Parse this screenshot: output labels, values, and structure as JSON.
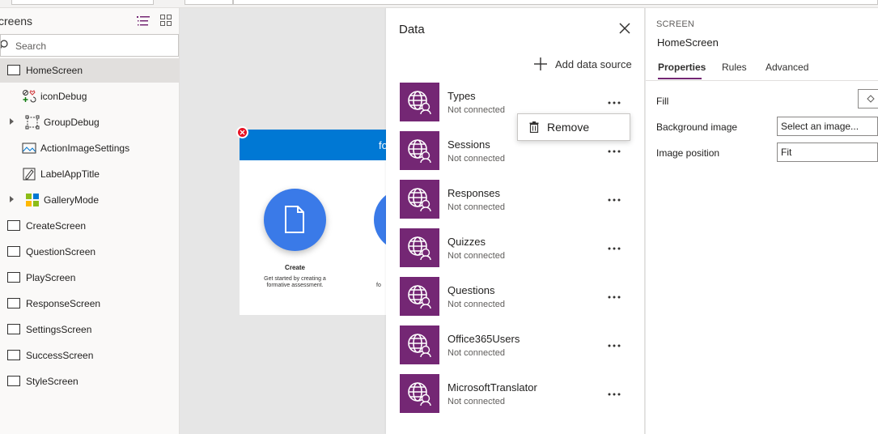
{
  "tree": {
    "title": "creens",
    "search_placeholder": "Search",
    "items": [
      {
        "label": "HomeScreen",
        "icon": "screen-icon",
        "selected": true
      },
      {
        "label": "iconDebug",
        "icon": "icon-control-icon"
      },
      {
        "label": "GroupDebug",
        "icon": "group-icon"
      },
      {
        "label": "ActionImageSettings",
        "icon": "image-icon"
      },
      {
        "label": "LabelAppTitle",
        "icon": "label-icon"
      },
      {
        "label": "GalleryMode",
        "icon": "gallery-icon"
      },
      {
        "label": "CreateScreen",
        "icon": "screen-icon"
      },
      {
        "label": "QuestionScreen",
        "icon": "screen-icon"
      },
      {
        "label": "PlayScreen",
        "icon": "screen-icon"
      },
      {
        "label": "ResponseScreen",
        "icon": "screen-icon"
      },
      {
        "label": "SettingsScreen",
        "icon": "screen-icon"
      },
      {
        "label": "SuccessScreen",
        "icon": "screen-icon"
      },
      {
        "label": "StyleScreen",
        "icon": "screen-icon"
      }
    ]
  },
  "canvas": {
    "header_text": "fo",
    "create_label": "Create",
    "create_desc": "Get started by creating a formative assessment.",
    "partial_desc": "fo"
  },
  "data_pane": {
    "title": "Data",
    "add_label": "Add data source",
    "sources": [
      {
        "name": "Types",
        "status": "Not connected"
      },
      {
        "name": "Sessions",
        "status": "Not connected"
      },
      {
        "name": "Responses",
        "status": "Not connected"
      },
      {
        "name": "Quizzes",
        "status": "Not connected"
      },
      {
        "name": "Questions",
        "status": "Not connected"
      },
      {
        "name": "Office365Users",
        "status": "Not connected"
      },
      {
        "name": "MicrosoftTranslator",
        "status": "Not connected"
      }
    ],
    "context_menu": {
      "remove_label": "Remove"
    }
  },
  "props": {
    "type_label": "SCREEN",
    "name": "HomeScreen",
    "tabs": [
      "Properties",
      "Rules",
      "Advanced"
    ],
    "fill_label": "Fill",
    "bg_image_label": "Background image",
    "bg_image_value": "Select an image...",
    "image_position_label": "Image position",
    "image_position_value": "Fit"
  },
  "colors": {
    "accent": "#742774",
    "header_blue": "#0078d4",
    "circle_blue": "#3a7ae8"
  }
}
